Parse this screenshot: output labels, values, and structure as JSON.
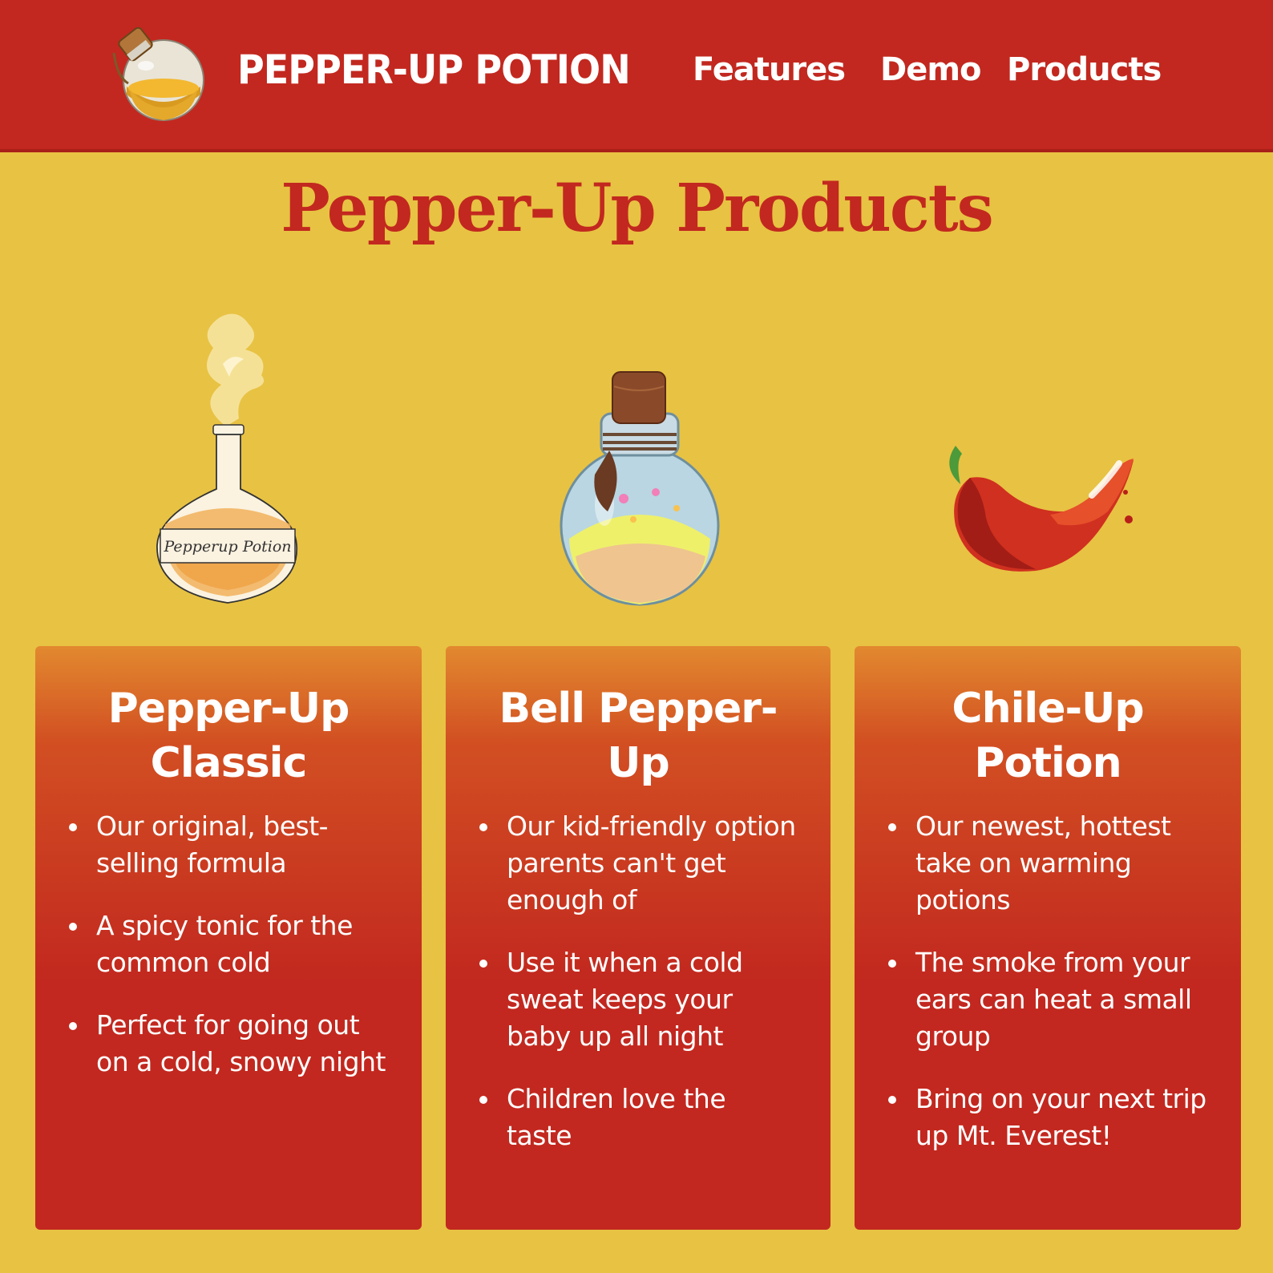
{
  "header": {
    "brand": "PEPPER-UP POTION",
    "logo_icon": "potion-bottle-icon",
    "nav": [
      "Features",
      "Demo",
      "Products"
    ]
  },
  "main": {
    "title": "Pepper-Up Products",
    "products": [
      {
        "image": "steaming-potion-flask-image",
        "image_label": "Pepperup Potion",
        "name": "Pepper-Up Classic",
        "features": [
          "Our original, best-selling formula",
          "A spicy tonic for the common cold",
          "Perfect for going out on a cold, snowy night"
        ]
      },
      {
        "image": "corked-potion-bottle-image",
        "name": "Bell Pepper-Up",
        "features": [
          "Our kid-friendly option parents can't get enough of",
          "Use it when a cold sweat keeps your baby up all night",
          "Children love the taste"
        ]
      },
      {
        "image": "red-chili-pepper-image",
        "name": "Chile-Up Potion",
        "features": [
          "Our newest, hottest take on warming potions",
          "The smoke from your ears can heat a small group",
          "Bring on your next trip up Mt. Everest!"
        ]
      }
    ]
  },
  "colors": {
    "header_bg": "#c2281f",
    "page_bg": "#e8c243",
    "card_top": "#e2892f",
    "card_bottom": "#c2281f",
    "text_light": "#ffffff"
  }
}
